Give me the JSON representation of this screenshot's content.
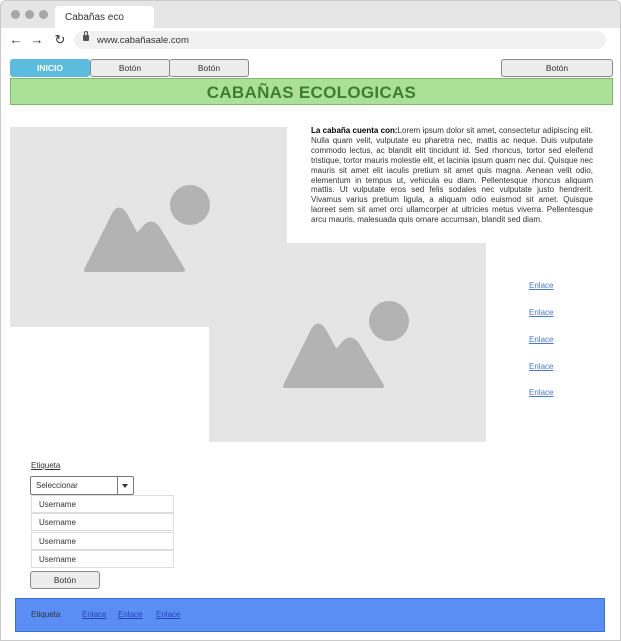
{
  "browser": {
    "tab_title": "Cabañas eco",
    "url": "www.cabañasale.com"
  },
  "nav": {
    "home": "INICIO",
    "button1": "Botón",
    "button2": "Botón",
    "button_right": "Botón"
  },
  "banner_title": "CABAÑAS ECOLOGICAS",
  "content": {
    "lead": "La cabaña cuenta con:",
    "body": "Lorem ipsum dolor sit amet, consectetur adipiscing elit. Nulla quam velit, vulputate eu pharetra nec, mattis ac neque. Duis vulputate commodo lectus, ac blandit elit tincidunt id. Sed rhoncus, tortor sed eleifend tristique, tortor mauris molestie elit, et lacinia ipsum quam nec dui. Quisque nec mauris sit amet elit iaculis pretium sit amet quis magna. Aenean velit odio, elementum in tempus ut, vehicula eu diam. Pellentesque rhoncus aliquam mattis. Ut vulputate eros sed felis sodales nec vulputate justo hendrerit. Vivamus varius pretium ligula, a aliquam odio euismod sit amet. Quisque laoreet sem sit amet orci ullamcorper at ultricies metus viverra. Pellentesque arcu mauris, malesuada quis ornare accumsan, blandit sed diam."
  },
  "side_links": [
    "Enlace",
    "Enlace",
    "Enlace",
    "Enlace",
    "Enlace"
  ],
  "form": {
    "label": "Etiqueta",
    "select_value": "Seleccionar",
    "options": [
      "Username",
      "Username",
      "Username",
      "Username"
    ],
    "button": "Botón"
  },
  "footer": {
    "label": "Etiqueta",
    "links": [
      "Enlace",
      "Enlace",
      "Enlace"
    ]
  },
  "colors": {
    "active_nav": "#5bbcde",
    "banner_bg": "#abe099",
    "banner_text": "#3f7d2f",
    "footer_bg": "#5b8ef5",
    "link": "#4a78d8"
  }
}
